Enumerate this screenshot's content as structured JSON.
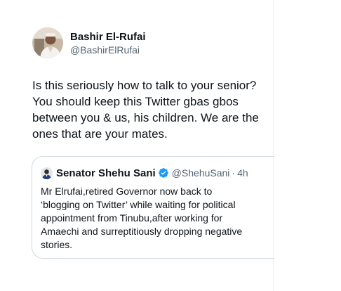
{
  "tweet": {
    "author": {
      "display_name": "Bashir El-Rufai",
      "handle": "@BashirElRufai"
    },
    "text": "Is this seriously how to talk to your senior?\nYou should keep this Twitter gbas gbos\nbetween you & us, his children. We are the\nones that are your mates."
  },
  "quoted_tweet": {
    "author": {
      "display_name": "Senator Shehu Sani",
      "handle": "@ShehuSani",
      "verified": true
    },
    "separator": "·",
    "time": "4h",
    "text": "Mr Elrufai,retired Governor now back to\n‘blogging on Twitter’ while waiting for political\nappointment from Tinubu,after working for\nAmaechi and surreptitiously dropping negative\nstories."
  },
  "colors": {
    "text_primary": "#0f1419",
    "text_secondary": "#536471",
    "border": "#cfd9de",
    "verified_blue": "#1d9bf0"
  },
  "icons": {
    "verified": "verified-badge-icon"
  }
}
